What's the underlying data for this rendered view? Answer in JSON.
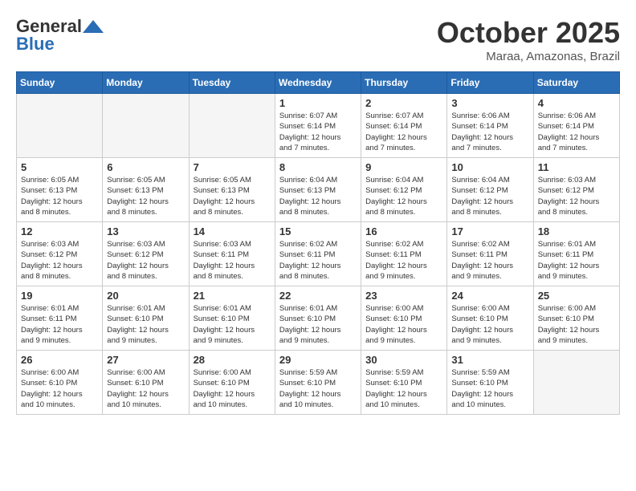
{
  "header": {
    "logo_general": "General",
    "logo_blue": "Blue",
    "month": "October 2025",
    "location": "Maraa, Amazonas, Brazil"
  },
  "weekdays": [
    "Sunday",
    "Monday",
    "Tuesday",
    "Wednesday",
    "Thursday",
    "Friday",
    "Saturday"
  ],
  "weeks": [
    [
      {
        "day": "",
        "empty": true
      },
      {
        "day": "",
        "empty": true
      },
      {
        "day": "",
        "empty": true
      },
      {
        "day": "1",
        "lines": [
          "Sunrise: 6:07 AM",
          "Sunset: 6:14 PM",
          "Daylight: 12 hours",
          "and 7 minutes."
        ]
      },
      {
        "day": "2",
        "lines": [
          "Sunrise: 6:07 AM",
          "Sunset: 6:14 PM",
          "Daylight: 12 hours",
          "and 7 minutes."
        ]
      },
      {
        "day": "3",
        "lines": [
          "Sunrise: 6:06 AM",
          "Sunset: 6:14 PM",
          "Daylight: 12 hours",
          "and 7 minutes."
        ]
      },
      {
        "day": "4",
        "lines": [
          "Sunrise: 6:06 AM",
          "Sunset: 6:14 PM",
          "Daylight: 12 hours",
          "and 7 minutes."
        ]
      }
    ],
    [
      {
        "day": "5",
        "lines": [
          "Sunrise: 6:05 AM",
          "Sunset: 6:13 PM",
          "Daylight: 12 hours",
          "and 8 minutes."
        ]
      },
      {
        "day": "6",
        "lines": [
          "Sunrise: 6:05 AM",
          "Sunset: 6:13 PM",
          "Daylight: 12 hours",
          "and 8 minutes."
        ]
      },
      {
        "day": "7",
        "lines": [
          "Sunrise: 6:05 AM",
          "Sunset: 6:13 PM",
          "Daylight: 12 hours",
          "and 8 minutes."
        ]
      },
      {
        "day": "8",
        "lines": [
          "Sunrise: 6:04 AM",
          "Sunset: 6:13 PM",
          "Daylight: 12 hours",
          "and 8 minutes."
        ]
      },
      {
        "day": "9",
        "lines": [
          "Sunrise: 6:04 AM",
          "Sunset: 6:12 PM",
          "Daylight: 12 hours",
          "and 8 minutes."
        ]
      },
      {
        "day": "10",
        "lines": [
          "Sunrise: 6:04 AM",
          "Sunset: 6:12 PM",
          "Daylight: 12 hours",
          "and 8 minutes."
        ]
      },
      {
        "day": "11",
        "lines": [
          "Sunrise: 6:03 AM",
          "Sunset: 6:12 PM",
          "Daylight: 12 hours",
          "and 8 minutes."
        ]
      }
    ],
    [
      {
        "day": "12",
        "lines": [
          "Sunrise: 6:03 AM",
          "Sunset: 6:12 PM",
          "Daylight: 12 hours",
          "and 8 minutes."
        ]
      },
      {
        "day": "13",
        "lines": [
          "Sunrise: 6:03 AM",
          "Sunset: 6:12 PM",
          "Daylight: 12 hours",
          "and 8 minutes."
        ]
      },
      {
        "day": "14",
        "lines": [
          "Sunrise: 6:03 AM",
          "Sunset: 6:11 PM",
          "Daylight: 12 hours",
          "and 8 minutes."
        ]
      },
      {
        "day": "15",
        "lines": [
          "Sunrise: 6:02 AM",
          "Sunset: 6:11 PM",
          "Daylight: 12 hours",
          "and 8 minutes."
        ]
      },
      {
        "day": "16",
        "lines": [
          "Sunrise: 6:02 AM",
          "Sunset: 6:11 PM",
          "Daylight: 12 hours",
          "and 9 minutes."
        ]
      },
      {
        "day": "17",
        "lines": [
          "Sunrise: 6:02 AM",
          "Sunset: 6:11 PM",
          "Daylight: 12 hours",
          "and 9 minutes."
        ]
      },
      {
        "day": "18",
        "lines": [
          "Sunrise: 6:01 AM",
          "Sunset: 6:11 PM",
          "Daylight: 12 hours",
          "and 9 minutes."
        ]
      }
    ],
    [
      {
        "day": "19",
        "lines": [
          "Sunrise: 6:01 AM",
          "Sunset: 6:11 PM",
          "Daylight: 12 hours",
          "and 9 minutes."
        ]
      },
      {
        "day": "20",
        "lines": [
          "Sunrise: 6:01 AM",
          "Sunset: 6:10 PM",
          "Daylight: 12 hours",
          "and 9 minutes."
        ]
      },
      {
        "day": "21",
        "lines": [
          "Sunrise: 6:01 AM",
          "Sunset: 6:10 PM",
          "Daylight: 12 hours",
          "and 9 minutes."
        ]
      },
      {
        "day": "22",
        "lines": [
          "Sunrise: 6:01 AM",
          "Sunset: 6:10 PM",
          "Daylight: 12 hours",
          "and 9 minutes."
        ]
      },
      {
        "day": "23",
        "lines": [
          "Sunrise: 6:00 AM",
          "Sunset: 6:10 PM",
          "Daylight: 12 hours",
          "and 9 minutes."
        ]
      },
      {
        "day": "24",
        "lines": [
          "Sunrise: 6:00 AM",
          "Sunset: 6:10 PM",
          "Daylight: 12 hours",
          "and 9 minutes."
        ]
      },
      {
        "day": "25",
        "lines": [
          "Sunrise: 6:00 AM",
          "Sunset: 6:10 PM",
          "Daylight: 12 hours",
          "and 9 minutes."
        ]
      }
    ],
    [
      {
        "day": "26",
        "lines": [
          "Sunrise: 6:00 AM",
          "Sunset: 6:10 PM",
          "Daylight: 12 hours",
          "and 10 minutes."
        ]
      },
      {
        "day": "27",
        "lines": [
          "Sunrise: 6:00 AM",
          "Sunset: 6:10 PM",
          "Daylight: 12 hours",
          "and 10 minutes."
        ]
      },
      {
        "day": "28",
        "lines": [
          "Sunrise: 6:00 AM",
          "Sunset: 6:10 PM",
          "Daylight: 12 hours",
          "and 10 minutes."
        ]
      },
      {
        "day": "29",
        "lines": [
          "Sunrise: 5:59 AM",
          "Sunset: 6:10 PM",
          "Daylight: 12 hours",
          "and 10 minutes."
        ]
      },
      {
        "day": "30",
        "lines": [
          "Sunrise: 5:59 AM",
          "Sunset: 6:10 PM",
          "Daylight: 12 hours",
          "and 10 minutes."
        ]
      },
      {
        "day": "31",
        "lines": [
          "Sunrise: 5:59 AM",
          "Sunset: 6:10 PM",
          "Daylight: 12 hours",
          "and 10 minutes."
        ]
      },
      {
        "day": "",
        "empty": true
      }
    ]
  ]
}
